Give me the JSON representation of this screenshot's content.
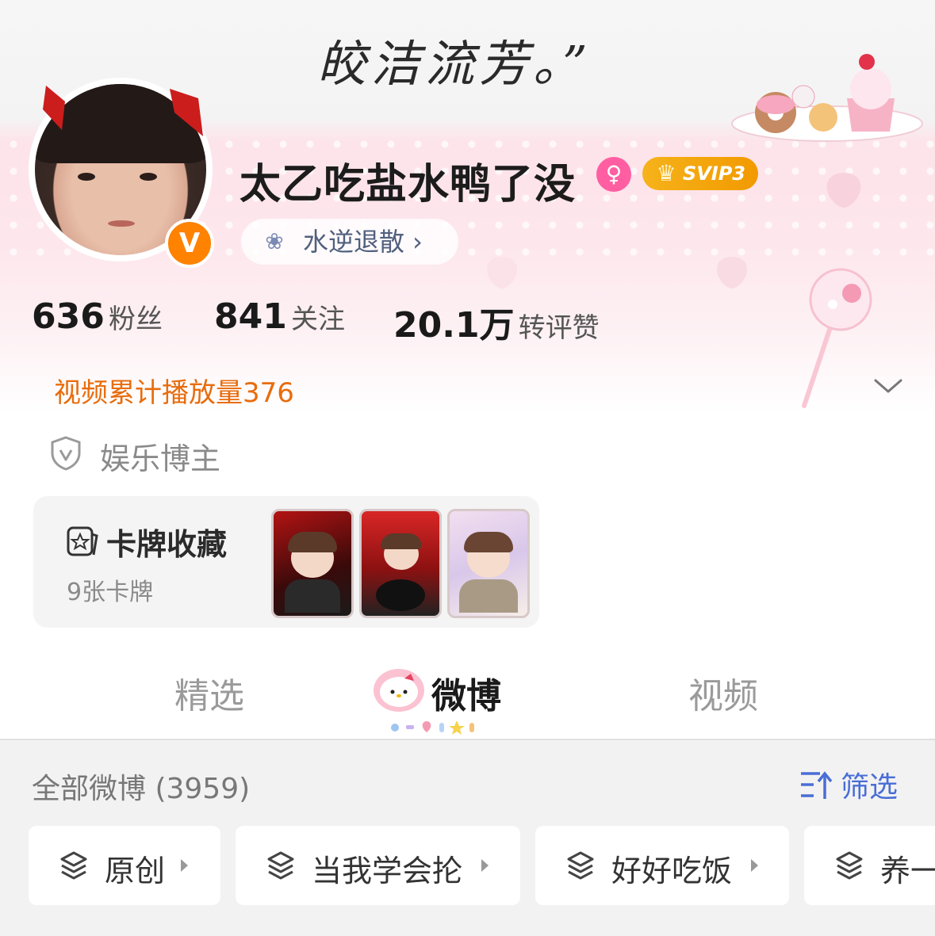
{
  "banner": {
    "text": "皎洁流芳。”"
  },
  "profile": {
    "username": "太乙吃盐水鸭了没",
    "svip_label": "SVIP3",
    "verified_badge": "V",
    "tag_label": "水逆退散 ›"
  },
  "stats": [
    {
      "value": "636",
      "label": "粉丝"
    },
    {
      "value": "841",
      "label": "关注"
    },
    {
      "value": "20.1万",
      "label": "转评赞"
    }
  ],
  "video_plays": "视频累计播放量376",
  "entertainment_label": "娱乐博主",
  "cards": {
    "title": "卡牌收藏",
    "count": "9张卡牌"
  },
  "tabs": [
    {
      "label": "精选",
      "active": false
    },
    {
      "label": "微博",
      "active": true
    },
    {
      "label": "视频",
      "active": false
    }
  ],
  "feed": {
    "count_label": "全部微博 (3959)",
    "filter_label": "筛选",
    "chips": [
      "原创",
      "当我学会抡",
      "好好吃饭",
      "养一"
    ]
  },
  "colors": {
    "accent_orange": "#e86c0c",
    "filter_blue": "#4a6ed6",
    "vip_gold": "#f6b21a"
  }
}
